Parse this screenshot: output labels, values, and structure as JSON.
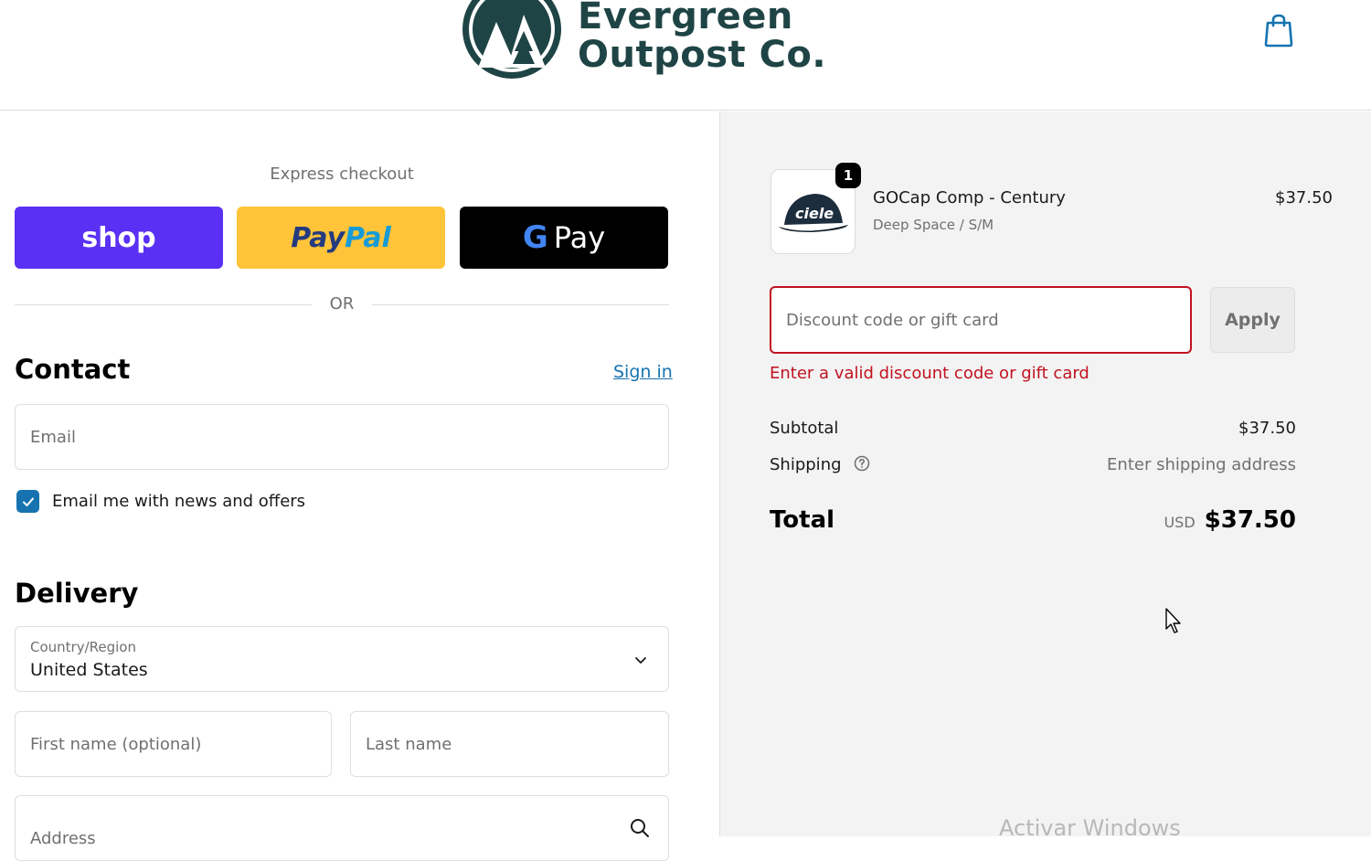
{
  "header": {
    "brand_line1": "Evergreen",
    "brand_line2": "Outpost Co.",
    "bag_icon": "shopping-bag-icon",
    "brand_color": "#1f4445"
  },
  "express": {
    "label": "Express checkout",
    "shop_label": "shop",
    "paypal_part1": "Pay",
    "paypal_part2": "Pal",
    "gpay_g": "G",
    "gpay_label": "Pay",
    "or_label": "OR"
  },
  "contact": {
    "title": "Contact",
    "sign_in": "Sign in",
    "email_placeholder": "Email",
    "newsletter_label": "Email me with news and offers",
    "newsletter_checked": true
  },
  "delivery": {
    "title": "Delivery",
    "country_label": "Country/Region",
    "country_value": "United States",
    "first_name_placeholder": "First name (optional)",
    "last_name_placeholder": "Last name",
    "address_placeholder": "Address"
  },
  "order": {
    "item_name": "GOCap Comp - Century",
    "item_variant": "Deep Space / S/M",
    "item_price": "$37.50",
    "item_qty": "1",
    "thumb_text": "ciele",
    "discount_placeholder": "Discount code or gift card",
    "apply_label": "Apply",
    "discount_error": "Enter a valid discount code or gift card",
    "subtotal_label": "Subtotal",
    "subtotal_value": "$37.50",
    "shipping_label": "Shipping",
    "shipping_value": "Enter shipping address",
    "total_label": "Total",
    "currency": "USD",
    "total_value": "$37.50"
  },
  "overlay": {
    "watermark": "Activar Windows"
  },
  "colors": {
    "accent_link": "#1773b0",
    "error": "#c1121f",
    "shop_purple": "#5a31f4",
    "paypal_yellow": "#ffc439"
  }
}
